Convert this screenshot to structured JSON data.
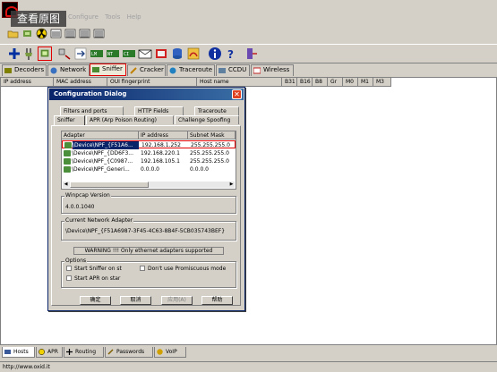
{
  "overlay_label": "查看原图",
  "menu": [
    "Configure",
    "Tools",
    "Help"
  ],
  "main_tabs": [
    {
      "label": "Decoders",
      "icon": "decoders-icon"
    },
    {
      "label": "Network",
      "icon": "network-icon"
    },
    {
      "label": "Sniffer",
      "icon": "sniffer-icon"
    },
    {
      "label": "Cracker",
      "icon": "cracker-icon"
    },
    {
      "label": "Traceroute",
      "icon": "traceroute-icon"
    },
    {
      "label": "CCDU",
      "icon": "ccdu-icon"
    },
    {
      "label": "Wireless",
      "icon": "wireless-icon"
    }
  ],
  "host_columns": [
    "IP address",
    "MAC address",
    "OUI fingerprint",
    "Host name",
    "B31",
    "B16",
    "B8",
    "Gr",
    "M0",
    "M1",
    "M3"
  ],
  "dialog": {
    "title": "Configuration Dialog",
    "tabs_row1": [
      "Filters and ports",
      "HTTP Fields",
      "Traceroute"
    ],
    "tabs_row2": [
      "Sniffer",
      "APR (Arp Poison Routing)",
      "Challenge Spoofing"
    ],
    "adapter_columns": [
      "Adapter",
      "IP address",
      "Subnet Mask"
    ],
    "adapters": [
      {
        "adapter": "\\Device\\NPF_{F51A6...",
        "ip": "192.168.1.252",
        "mask": "255.255.255.0"
      },
      {
        "adapter": "\\Device\\NPF_{DD6F3...",
        "ip": "192.168.220.1",
        "mask": "255.255.255.0"
      },
      {
        "adapter": "\\Device\\NPF_{C0987...",
        "ip": "192.168.105.1",
        "mask": "255.255.255.0"
      },
      {
        "adapter": "\\Device\\NPF_Generi...",
        "ip": "0.0.0.0",
        "mask": "0.0.0.0"
      }
    ],
    "winpcap_label": "Winpcap Version",
    "winpcap_version": "4.0.0.1040",
    "current_adapter_label": "Current Network Adapter",
    "current_adapter": "\\Device\\NPF_{F51A6987-3F45-4C63-8B4F-5CB035743BEF}",
    "warning": "WARNING !!! Only ethernet adapters supported",
    "options_label": "Options",
    "opt_start_sniffer": "Start Sniffer on st",
    "opt_no_promiscuous": "Don't use Promiscuous mode",
    "opt_start_apr": "Start APR on star",
    "buttons": {
      "ok": "确定",
      "cancel": "取消",
      "apply": "应用(A)",
      "help": "帮助"
    }
  },
  "bottom_tabs": [
    {
      "label": "Hosts",
      "icon": "hosts-icon"
    },
    {
      "label": "APR",
      "icon": "apr-icon"
    },
    {
      "label": "Routing",
      "icon": "routing-icon"
    },
    {
      "label": "Passwords",
      "icon": "passwords-icon"
    },
    {
      "label": "VoIP",
      "icon": "voip-icon"
    }
  ],
  "status_url": "http://www.oxid.it"
}
